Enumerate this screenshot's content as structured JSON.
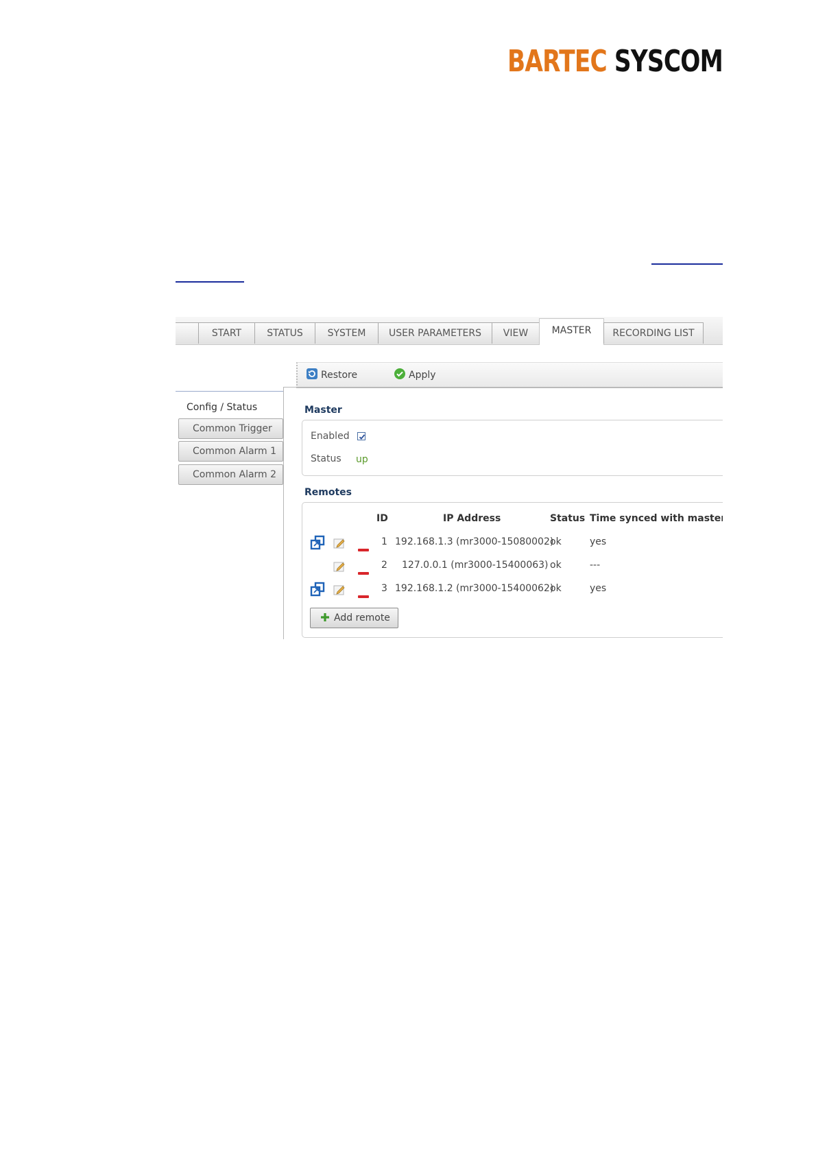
{
  "logo": {
    "part1": "BARTEC",
    "part2": "SYSCOM"
  },
  "tabs": [
    {
      "label": "START"
    },
    {
      "label": "STATUS"
    },
    {
      "label": "SYSTEM"
    },
    {
      "label": "USER PARAMETERS"
    },
    {
      "label": "VIEW"
    },
    {
      "label": "MASTER",
      "active": true
    },
    {
      "label": "RECORDING LIST"
    }
  ],
  "toolbar": {
    "restore_label": "Restore",
    "apply_label": "Apply"
  },
  "sidebar": {
    "items": [
      {
        "label": "Config / Status",
        "active": true
      },
      {
        "label": "Common Trigger"
      },
      {
        "label": "Common Alarm 1"
      },
      {
        "label": "Common Alarm 2"
      }
    ]
  },
  "master": {
    "title": "Master",
    "enabled_label": "Enabled",
    "enabled": true,
    "status_label": "Status",
    "status_value": "up"
  },
  "remotes": {
    "title": "Remotes",
    "columns": [
      "ID",
      "IP Address",
      "Status",
      "Time synced with master"
    ],
    "rows": [
      {
        "id": "1",
        "ip": "192.168.1.3 (mr3000-15080002)",
        "status": "ok",
        "synced": "yes",
        "link": true
      },
      {
        "id": "2",
        "ip": "127.0.0.1 (mr3000-15400063)",
        "status": "ok",
        "synced": "---",
        "link": false
      },
      {
        "id": "3",
        "ip": "192.168.1.2 (mr3000-15400062)",
        "status": "ok",
        "synced": "yes",
        "link": true
      }
    ],
    "add_label": "Add remote"
  },
  "colors": {
    "brand_orange": "#e2761b",
    "heading_blue": "#1e3a5f",
    "status_green": "#5a9a2a",
    "remove_red": "#d9262b",
    "link_blue": "#1f63b8"
  },
  "icons": [
    "restore-icon",
    "apply-icon",
    "open-remote-icon",
    "edit-icon",
    "remove-icon",
    "add-icon",
    "checkbox-checked-icon"
  ]
}
